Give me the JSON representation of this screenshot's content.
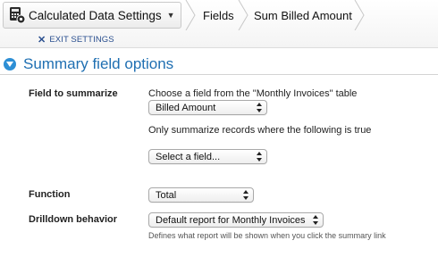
{
  "toolbar": {
    "settings_menu_label": "Calculated Data Settings",
    "exit_label": "EXIT SETTINGS",
    "breadcrumbs": [
      "Fields",
      "Sum Billed Amount"
    ]
  },
  "section": {
    "title": "Summary field options"
  },
  "form": {
    "field_to_summarize": {
      "label": "Field to summarize",
      "prompt": "Choose a field from the \"Monthly Invoices\" table",
      "selected": "Billed Amount"
    },
    "filter": {
      "prompt": "Only summarize records where the following is true",
      "selected": "Select a field..."
    },
    "function": {
      "label": "Function",
      "selected": "Total"
    },
    "drilldown": {
      "label": "Drilldown behavior",
      "selected": "Default report for Monthly Invoices",
      "hint": "Defines what report will be shown when you click the summary link"
    }
  },
  "colors": {
    "accent": "#1f6fb2",
    "collapse_button": "#2d8fd5",
    "link": "#2a4f8f"
  },
  "icons": [
    "calculator-gear-icon",
    "chevron-down-icon",
    "close-icon",
    "collapse-icon",
    "select-arrows-icon"
  ]
}
